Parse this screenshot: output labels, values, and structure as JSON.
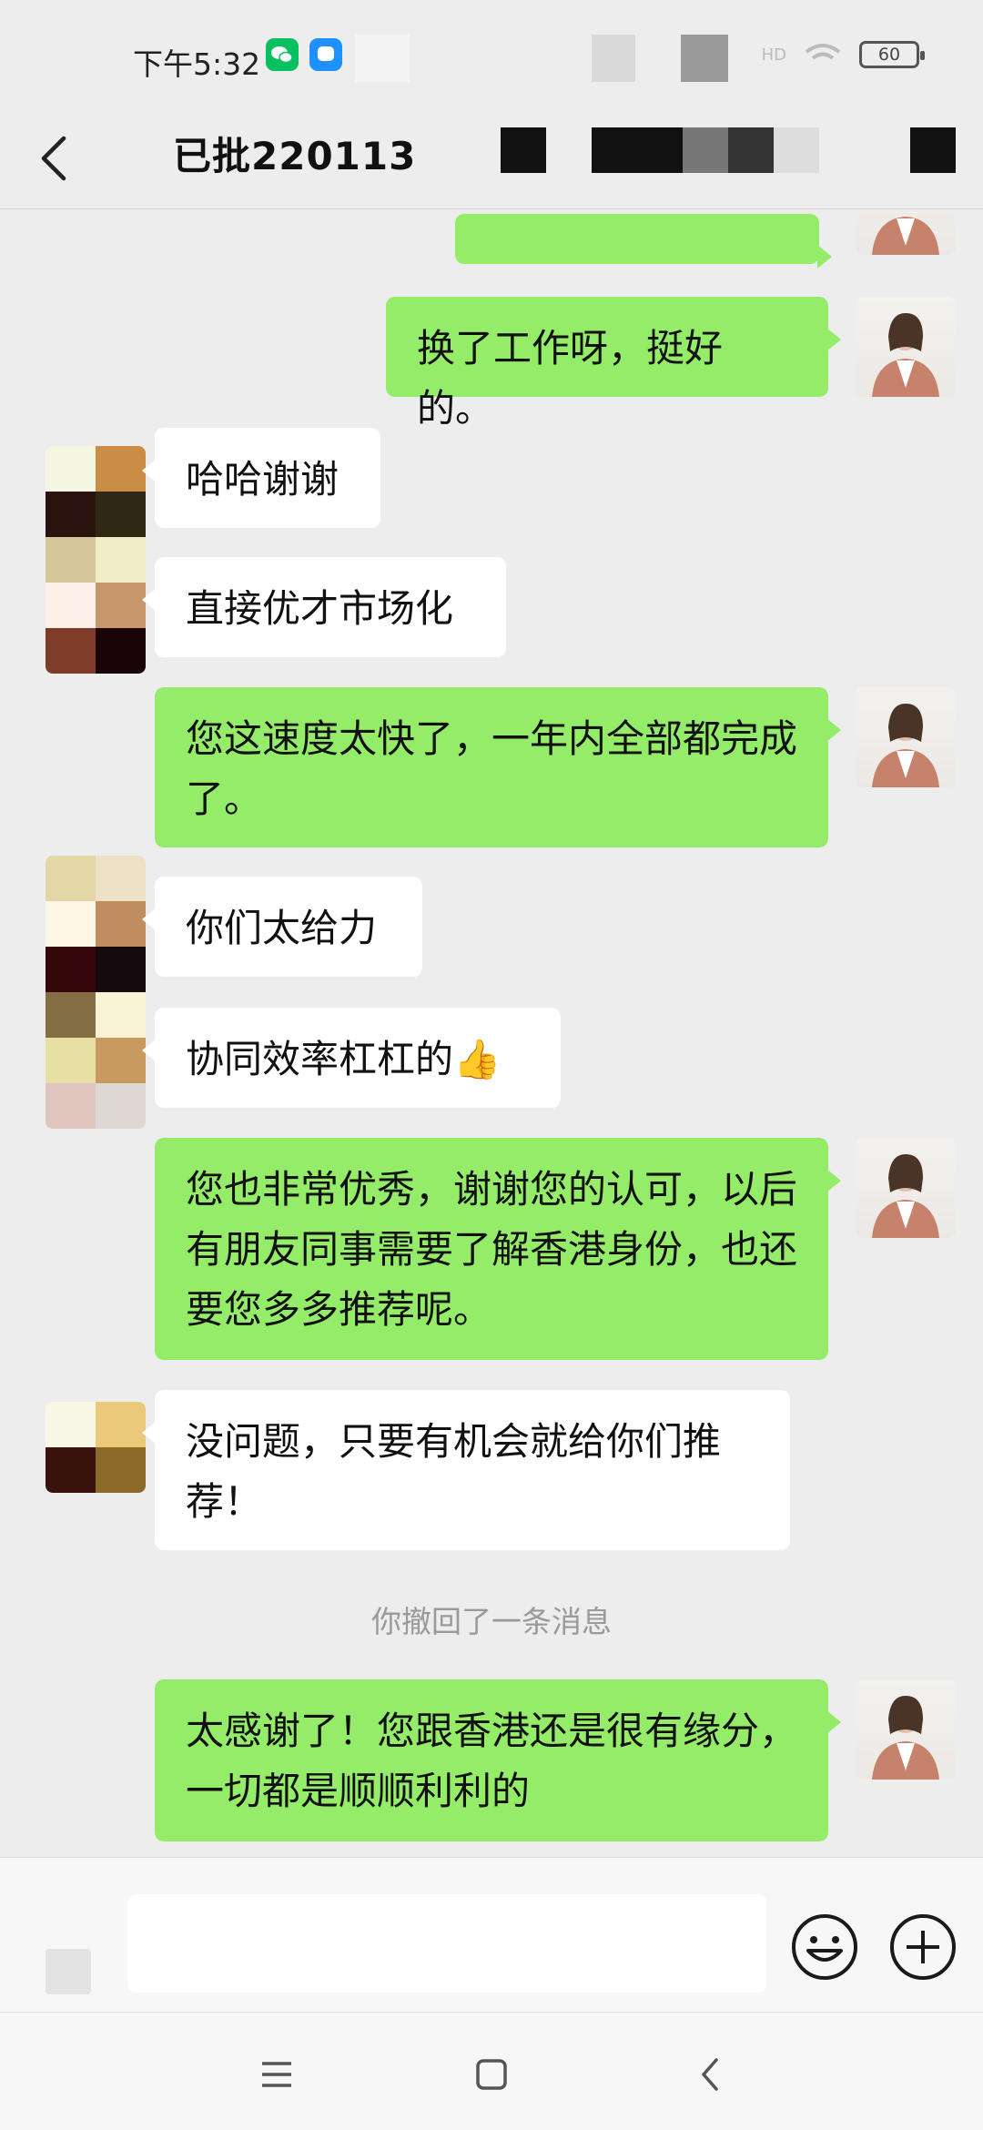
{
  "status_bar": {
    "time": "下午5:32",
    "battery": "60"
  },
  "header": {
    "title": "已批220113"
  },
  "messages": [
    {
      "side": "me",
      "text": ""
    },
    {
      "side": "me",
      "text": "换了工作呀，挺好的。"
    },
    {
      "side": "them",
      "text": "哈哈谢谢"
    },
    {
      "side": "them",
      "text": "直接优才市场化"
    },
    {
      "side": "me",
      "text": "您这速度太快了，一年内全部都完成了。"
    },
    {
      "side": "them",
      "text": "你们太给力"
    },
    {
      "side": "them",
      "text": "协同效率杠杠的",
      "emoji": "👍"
    },
    {
      "side": "me",
      "text": "您也非常优秀，谢谢您的认可，以后有朋友同事需要了解香港身份，也还要您多多推荐呢。"
    },
    {
      "side": "them",
      "text": "没问题，只要有机会就给你们推荐！"
    },
    {
      "side": "me",
      "text": "太感谢了！您跟香港还是很有缘分，一切都是顺顺利利的"
    }
  ],
  "system_message": "你撤回了一条消息",
  "input": {
    "value": "",
    "placeholder": ""
  },
  "colors": {
    "my_bubble": "#95ec69",
    "their_bubble": "#ffffff",
    "background": "#ededed"
  },
  "icons": {
    "back": "chevron-left-icon",
    "emoji": "smiley-icon",
    "more": "plus-circle-icon",
    "menu": "menu-icon",
    "home": "home-square-icon",
    "system_back": "back-icon"
  }
}
